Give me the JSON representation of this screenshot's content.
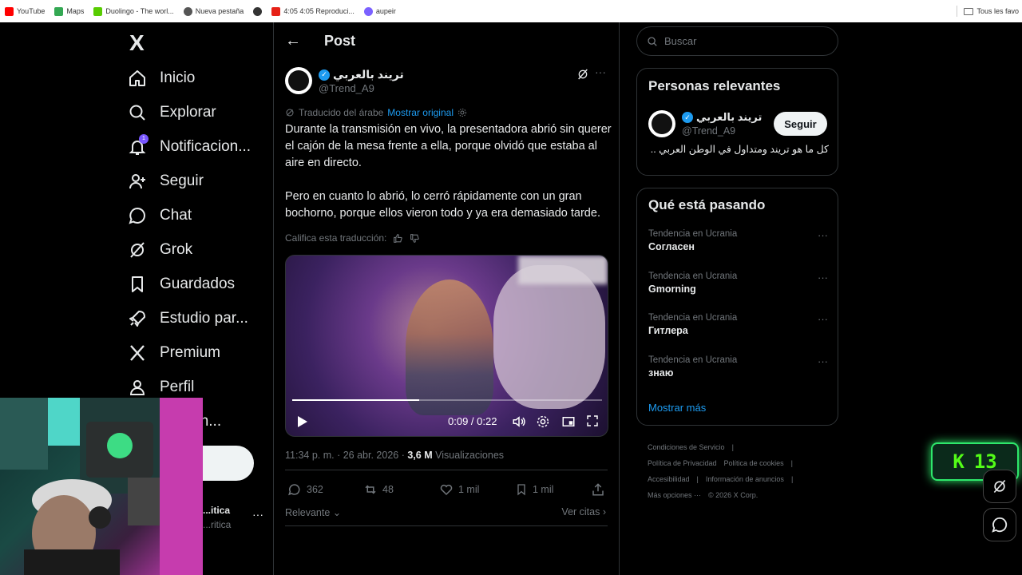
{
  "bookmarks": [
    {
      "label": "YouTube",
      "color": "#ff0000"
    },
    {
      "label": "Maps",
      "color": "#34a853"
    },
    {
      "label": "Duolingo - The worl...",
      "color": "#58cc02"
    },
    {
      "label": "Nueva pestaña",
      "color": "#555555"
    },
    {
      "label": "",
      "color": "#333333"
    },
    {
      "label": "4:05 4:05 Reproduci...",
      "color": "#e62117"
    },
    {
      "label": "aupeir",
      "color": "#7b61ff"
    }
  ],
  "bookmarks_right": "Tous les favo",
  "nav": {
    "logo": "X",
    "items": [
      {
        "label": "Inicio",
        "icon": "home-icon"
      },
      {
        "label": "Explorar",
        "icon": "search-icon"
      },
      {
        "label": "Notificacion...",
        "icon": "bell-icon",
        "badge": "1"
      },
      {
        "label": "Seguir",
        "icon": "add-user-icon"
      },
      {
        "label": "Chat",
        "icon": "chat-icon"
      },
      {
        "label": "Grok",
        "icon": "grok-icon"
      },
      {
        "label": "Guardados",
        "icon": "bookmark-icon"
      },
      {
        "label": "Estudio par...",
        "icon": "rocket-icon"
      },
      {
        "label": "Premium",
        "icon": "x-icon"
      },
      {
        "label": "Perfil",
        "icon": "profile-icon"
      },
      {
        "label": "...ocion...",
        "icon": "more-icon"
      }
    ],
    "post_button": "r",
    "account": {
      "name": "...itica",
      "handle": "...ritica",
      "more": "···"
    }
  },
  "header": {
    "back": "←",
    "title": "Post"
  },
  "post": {
    "author_name": "تريند بالعربي",
    "author_handle": "@Trend_A9",
    "translated_label": "Traducido del árabe",
    "show_original": "Mostrar original",
    "paragraphs": [
      "Durante la transmisión en vivo, la presentadora abrió sin querer el cajón de la mesa frente a ella, porque olvidó que estaba al aire en directo.",
      "Pero en cuanto lo abrió, lo cerró rápidamente con un gran bochorno, porque ellos vieron todo y ya era demasiado tarde."
    ],
    "rate_label": "Califica esta traducción:",
    "video": {
      "time": "0:09 / 0:22",
      "progress": 0.41
    },
    "time": "11:34 p. m. · 26 abr. 2026 ·",
    "views_count": "3,6 M",
    "views_label": "Visualizaciones",
    "stats": {
      "replies": "362",
      "reposts": "48",
      "likes": "1 mil",
      "bookmarks": "1 mil"
    },
    "sort_label": "Relevante",
    "quotes_label": "Ver citas"
  },
  "sidebar": {
    "search_placeholder": "Buscar",
    "relevant_title": "Personas relevantes",
    "relevant": {
      "name": "تريند بالعربي",
      "handle": "@Trend_A9",
      "follow": "Seguir",
      "bio": "كل ما هو تريند ومتداول في الوطن العربي .."
    },
    "trending_title": "Qué está pasando",
    "trends": [
      {
        "context": "Tendencia en Ucrania",
        "title": "Согласен"
      },
      {
        "context": "Tendencia en Ucrania",
        "title": "Gmorning"
      },
      {
        "context": "Tendencia en Ucrania",
        "title": "Гитлера"
      },
      {
        "context": "Tendencia en Ucrania",
        "title": "знаю"
      }
    ],
    "show_more": "Mostrar más",
    "footer": [
      "Condiciones de Servicio",
      "|",
      "Política de Privacidad",
      "Política de cookies",
      "|",
      "Accesibilidad",
      "|",
      "Información de anuncios",
      "|",
      "Más opciones ···",
      "© 2026 X Corp."
    ]
  },
  "kick_widget": {
    "letter": "K",
    "count": "13"
  },
  "colors": {
    "accent": "#1d9bf0",
    "kick": "#53fc18",
    "badge": "#7856ff"
  }
}
